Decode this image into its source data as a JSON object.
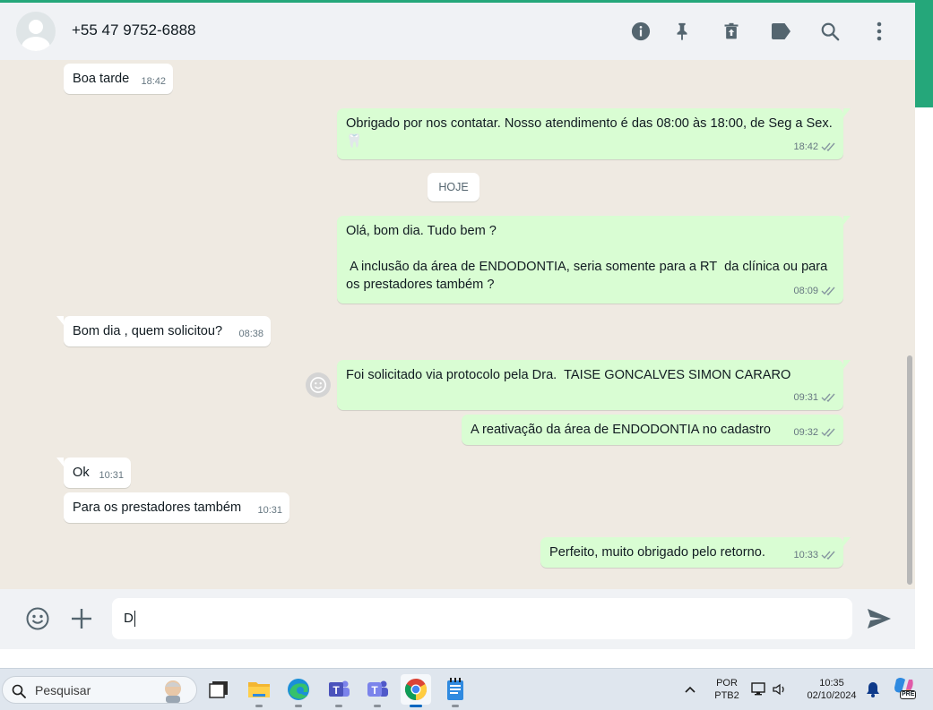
{
  "header": {
    "contact_name": "+55 47 9752-6888",
    "icons": [
      "info-icon",
      "pin-icon",
      "delete-icon",
      "label-icon",
      "search-icon",
      "menu-dots-icon"
    ]
  },
  "chat": {
    "day_divider": "HOJE",
    "messages": [
      {
        "direction": "in",
        "text": "Boa tarde",
        "time": "18:42"
      },
      {
        "direction": "out",
        "text": "Obrigado por nos contatar. Nosso atendimento é das 08:00 às 18:00, de Seg a Sex.🦷",
        "time": "18:42",
        "status": "read"
      },
      {
        "direction": "out",
        "text": "Olá, bom dia. Tudo bem ?\n\n A inclusão da área de ENDODONTIA, seria somente para a RT  da clínica ou para os prestadores também ?",
        "time": "08:09",
        "status": "read"
      },
      {
        "direction": "in",
        "text": "Bom dia , quem solicitou?",
        "time": "08:38"
      },
      {
        "direction": "out",
        "text": "Foi solicitado via protocolo pela Dra.  TAISE GONCALVES SIMON CARARO",
        "time": "09:31",
        "status": "read"
      },
      {
        "direction": "out",
        "text": "A reativação da área de ENDODONTIA no cadastro",
        "time": "09:32",
        "status": "read"
      },
      {
        "direction": "in",
        "text": "Ok",
        "time": "10:31"
      },
      {
        "direction": "in",
        "text": "Para os prestadores também",
        "time": "10:31"
      },
      {
        "direction": "out",
        "text": "Perfeito, muito obrigado pelo retorno.",
        "time": "10:33",
        "status": "read"
      }
    ]
  },
  "composer": {
    "value": "D",
    "icons": [
      "emoji-icon",
      "plus-icon",
      "send-icon"
    ]
  },
  "taskbar": {
    "search_label": "Pesquisar",
    "language": "POR",
    "keyboard": "PTB2",
    "time": "10:35",
    "date": "02/10/2024",
    "apps": [
      "task-view",
      "file-explorer",
      "edge",
      "teams-business",
      "teams",
      "chrome",
      "notepad"
    ],
    "copilot_badge": "PRE"
  },
  "colors": {
    "accent": "#25a77a",
    "incoming_bubble": "#ffffff",
    "outgoing_bubble": "#d9fdd3",
    "read_ticks": "#8696a0",
    "chat_background": "#efeae2"
  }
}
